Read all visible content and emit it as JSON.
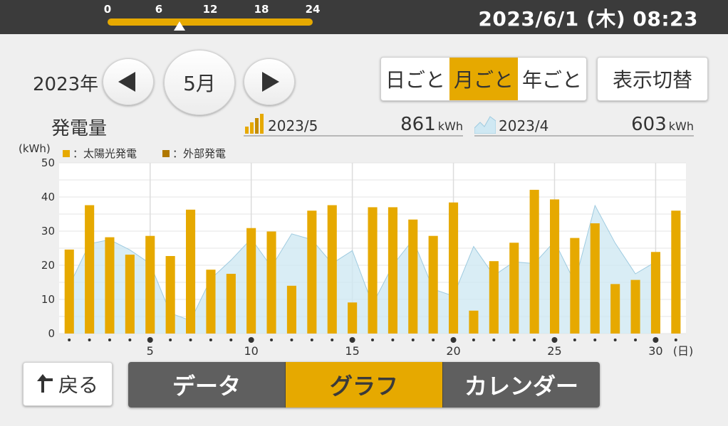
{
  "timeline": {
    "ticks": [
      "0",
      "6",
      "12",
      "18",
      "24"
    ]
  },
  "datetime": "2023/6/1 (木) 08:23",
  "year_label": "2023年",
  "month_label": "5月",
  "period_tabs": [
    {
      "label": "日ごと",
      "active": false
    },
    {
      "label": "月ごと",
      "active": true
    },
    {
      "label": "年ごと",
      "active": false
    }
  ],
  "toggle_label": "表示切替",
  "section_title": "発電量",
  "summary": [
    {
      "period": "2023/5",
      "value": "861",
      "unit": "kWh"
    },
    {
      "period": "2023/4",
      "value": "603",
      "unit": "kWh"
    }
  ],
  "unit_label": "(kWh)",
  "legend": [
    {
      "label": "：太陽光発電",
      "color": "#e6a900"
    },
    {
      "label": "：外部発電",
      "color": "#b07800"
    }
  ],
  "back_label": "戻る",
  "view_tabs": [
    {
      "label": "データ",
      "active": false
    },
    {
      "label": "グラフ",
      "active": true
    },
    {
      "label": "カレンダー",
      "active": false
    }
  ],
  "colors": {
    "accent": "#e6a900",
    "dark": "#3b3b3b",
    "area": "#cfe8f3",
    "area_line": "#9fcbe0"
  },
  "chart_data": {
    "type": "bar",
    "xlabel": "(日)",
    "ylabel": "(kWh)",
    "ylim": [
      0,
      50
    ],
    "yticks": [
      0,
      10,
      20,
      30,
      40,
      50
    ],
    "xtick_labels": [
      {
        "day": 5,
        "label": "5"
      },
      {
        "day": 10,
        "label": "10"
      },
      {
        "day": 15,
        "label": "15"
      },
      {
        "day": 20,
        "label": "20"
      },
      {
        "day": 25,
        "label": "25"
      },
      {
        "day": 30,
        "label": "30"
      }
    ],
    "x": [
      1,
      2,
      3,
      4,
      5,
      6,
      7,
      8,
      9,
      10,
      11,
      12,
      13,
      14,
      15,
      16,
      17,
      18,
      19,
      20,
      21,
      22,
      23,
      24,
      25,
      26,
      27,
      28,
      29,
      30,
      31
    ],
    "series": [
      {
        "name": "2023/5",
        "kind": "bar",
        "values": [
          24.6,
          37.6,
          28.2,
          23.1,
          28.6,
          22.7,
          36.3,
          18.7,
          17.5,
          30.9,
          29.9,
          14.0,
          36.0,
          37.6,
          9.1,
          37.0,
          37.0,
          33.4,
          28.6,
          38.4,
          6.7,
          21.2,
          26.6,
          42.1,
          39.3,
          28.0,
          32.3,
          14.5,
          15.7,
          23.9,
          36.0
        ]
      },
      {
        "name": "2023/4",
        "kind": "area",
        "values": [
          14.0,
          26.3,
          27.5,
          24.5,
          20.5,
          6.0,
          3.8,
          16.0,
          21.5,
          27.8,
          19.5,
          29.2,
          27.5,
          20.5,
          24.3,
          8.5,
          20.0,
          27.5,
          13.0,
          11.0,
          25.5,
          17.0,
          21.0,
          20.5,
          27.0,
          15.0,
          37.5,
          26.5,
          17.5,
          21.0
        ]
      }
    ]
  }
}
